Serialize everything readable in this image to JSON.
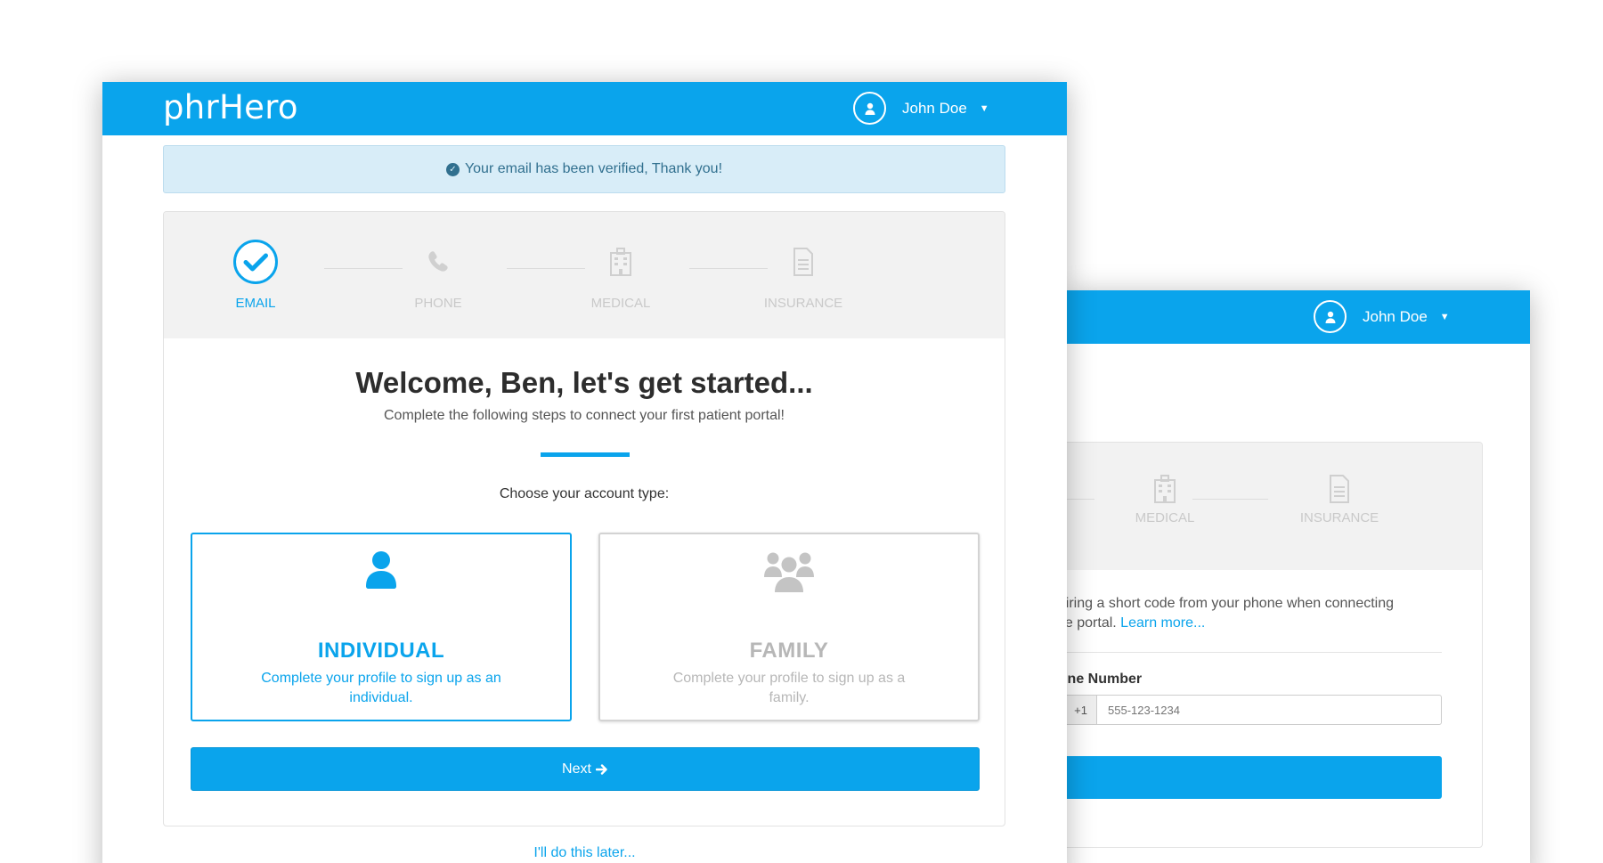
{
  "app": {
    "logo": "phrHero",
    "accent_color": "#0aa4ec"
  },
  "user": {
    "name": "John Doe",
    "avatar_icon": "user-icon",
    "menu_icon": "caret-down-icon"
  },
  "alert": {
    "text": "Your email has been verified, Thank you!",
    "icon": "check-circle-icon"
  },
  "steps": [
    {
      "label": "EMAIL",
      "icon": "check-circle-icon",
      "state": "complete"
    },
    {
      "label": "PHONE",
      "icon": "phone-icon",
      "state": "pending"
    },
    {
      "label": "MEDICAL",
      "icon": "hospital-icon",
      "state": "pending"
    },
    {
      "label": "INSURANCE",
      "icon": "document-icon",
      "state": "pending"
    }
  ],
  "main": {
    "title": "Welcome, Ben, let's get started...",
    "subtitle": "Complete the following steps to connect your first patient portal!",
    "choose_label": "Choose your account type:",
    "account_types": [
      {
        "title": "INDIVIDUAL",
        "description": "Complete your profile to sign up as an individual.",
        "icon": "user-icon",
        "selected": true
      },
      {
        "title": "FAMILY",
        "description": "Complete your profile to sign up as a family.",
        "icon": "users-icon",
        "selected": false
      }
    ],
    "next_label": "Next",
    "next_icon": "arrow-right-icon",
    "later_link": "I'll do this later..."
  },
  "back_window": {
    "user_name": "John Doe",
    "steps": [
      {
        "label": "MEDICAL",
        "icon": "hospital-icon"
      },
      {
        "label": "INSURANCE",
        "icon": "document-icon"
      }
    ],
    "text_line1": "quiring a short code from your phone when connecting",
    "text_line2": "nce portal.",
    "learn_more": "Learn more...",
    "phone_label": "hone Number",
    "phone_prefix": "+1",
    "phone_placeholder": "555-123-1234"
  }
}
